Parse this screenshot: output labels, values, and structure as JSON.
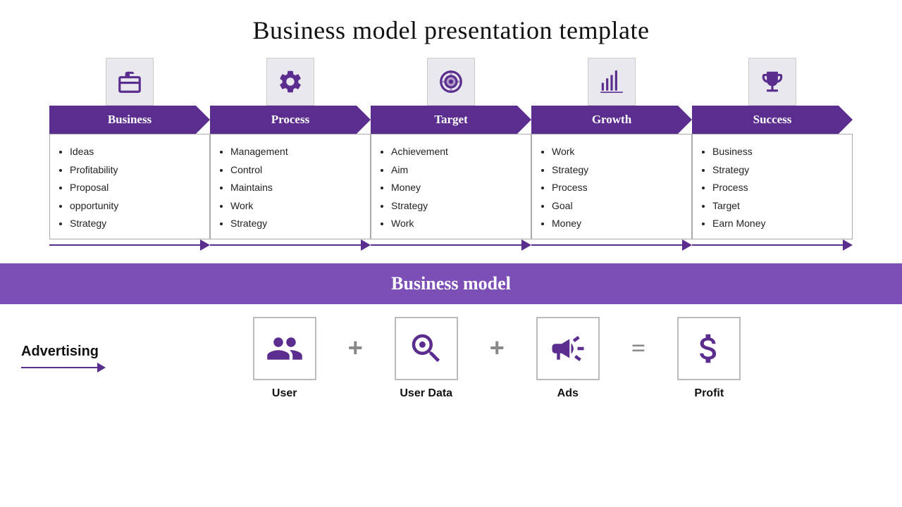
{
  "page": {
    "title": "Business model presentation template"
  },
  "arrows": [
    {
      "id": "business",
      "label": "Business",
      "icon": "briefcase",
      "items": [
        "Ideas",
        "Profitability",
        "Proposal",
        "opportunity",
        "Strategy"
      ]
    },
    {
      "id": "process",
      "label": "Process",
      "icon": "gear",
      "items": [
        "Management",
        "Control",
        "Maintains",
        "Work",
        "Strategy"
      ]
    },
    {
      "id": "target",
      "label": "Target",
      "icon": "target",
      "items": [
        "Achievement",
        "Aim",
        "Money",
        "Strategy",
        "Work"
      ]
    },
    {
      "id": "growth",
      "label": "Growth",
      "icon": "chart",
      "items": [
        "Work",
        "Strategy",
        "Process",
        "Goal",
        "Money"
      ]
    },
    {
      "id": "success",
      "label": "Success",
      "icon": "trophy",
      "items": [
        "Business",
        "Strategy",
        "Process",
        "Target",
        "Earn Money"
      ]
    }
  ],
  "banner": {
    "label": "Business model"
  },
  "bottom": {
    "advertising_label": "Advertising",
    "items": [
      {
        "id": "user",
        "label": "User",
        "icon": "users"
      },
      {
        "id": "user-data",
        "label": "User Data",
        "icon": "search-users"
      },
      {
        "id": "ads",
        "label": "Ads",
        "icon": "megaphone"
      },
      {
        "id": "profit",
        "label": "Profit",
        "icon": "money"
      }
    ],
    "operators": [
      "+",
      "+",
      "="
    ]
  }
}
